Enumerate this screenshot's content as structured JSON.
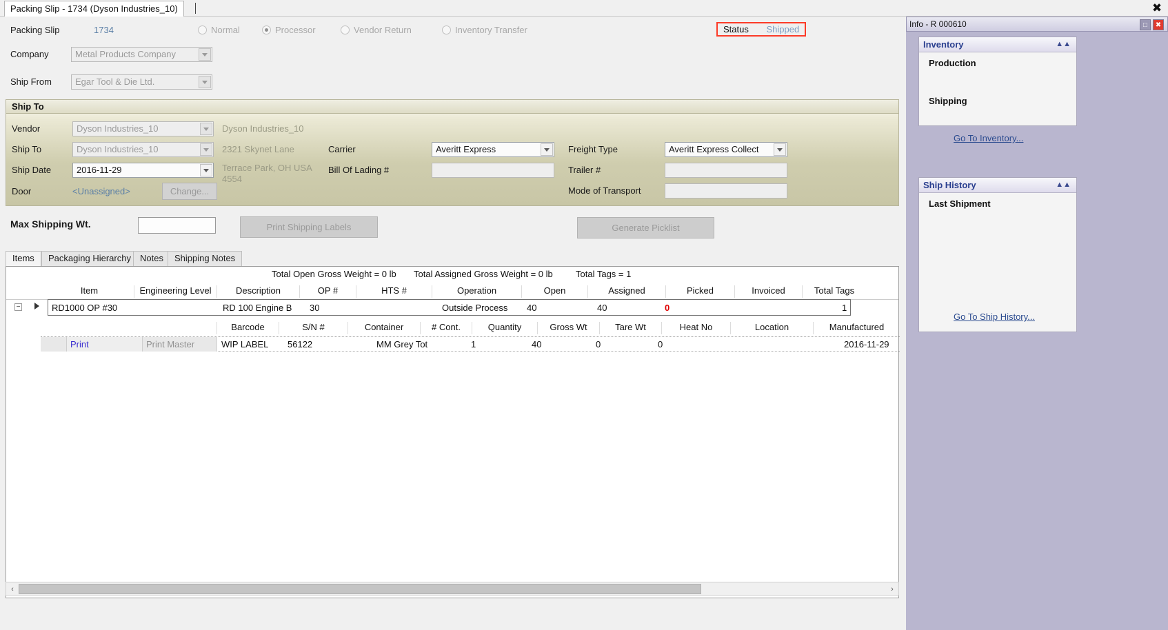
{
  "window": {
    "tab_title": "Packing Slip - 1734 (Dyson Industries_10)",
    "close_icon": "close-icon"
  },
  "header": {
    "packing_slip_label": "Packing Slip",
    "packing_slip_value": "1734",
    "company_label": "Company",
    "company_value": "Metal Products Company",
    "ship_from_label": "Ship From",
    "ship_from_value": "Egar Tool & Die Ltd.",
    "types": [
      {
        "label": "Normal",
        "selected": false
      },
      {
        "label": "Processor",
        "selected": true
      },
      {
        "label": "Vendor Return",
        "selected": false
      },
      {
        "label": "Inventory Transfer",
        "selected": false
      }
    ],
    "status_label": "Status",
    "status_value": "Shipped",
    "status_highlight_color": "#fc3b28"
  },
  "ship_to": {
    "group_title": "Ship To",
    "vendor_label": "Vendor",
    "vendor_value": "Dyson Industries_10",
    "vendor_display": "Dyson Industries_10",
    "ship_to_label": "Ship To",
    "ship_to_value": "Dyson Industries_10",
    "address_line1": "2321 Skynet Lane",
    "address_line2": "Terrace Park, OH USA",
    "address_line3": "4554",
    "ship_date_label": "Ship Date",
    "ship_date_value": "2016-11-29",
    "door_label": "Door",
    "door_value": "<Unassigned>",
    "change_button": "Change...",
    "carrier_label": "Carrier",
    "carrier_value": "Averitt Express",
    "bol_label": "Bill Of Lading #",
    "bol_value": "",
    "freight_type_label": "Freight Type",
    "freight_type_value": "Averitt Express Collect",
    "trailer_label": "Trailer #",
    "trailer_value": "",
    "mode_label": "Mode of Transport",
    "mode_value": ""
  },
  "shipping_bar": {
    "max_weight_label": "Max Shipping Wt.",
    "max_weight_value": "",
    "print_labels_button": "Print Shipping Labels",
    "generate_picklist_button": "Generate Picklist"
  },
  "tabs": [
    {
      "label": "Items",
      "active": true
    },
    {
      "label": "Packaging Hierarchy",
      "active": false
    },
    {
      "label": "Notes",
      "active": false
    },
    {
      "label": "Shipping Notes",
      "active": false
    }
  ],
  "grid": {
    "totals": [
      "Total Open Gross Weight = 0 lb",
      "Total Assigned Gross Weight = 0 lb",
      "Total Tags = 1"
    ],
    "columns": [
      "Item",
      "Engineering Level",
      "Description",
      "OP #",
      "HTS #",
      "Operation",
      "Open",
      "Assigned",
      "Picked",
      "Invoiced",
      "Total Tags"
    ],
    "rows": [
      {
        "item": "RD1000 OP #30",
        "engineering_level": "",
        "description": "RD 100 Engine B",
        "op": "30",
        "hts": "",
        "operation": "Outside Process",
        "open": "40",
        "assigned": "40",
        "picked": "0",
        "invoiced": "",
        "total_tags": "1"
      }
    ],
    "sub_columns": [
      "Barcode",
      "S/N #",
      "Container",
      "# Cont.",
      "Quantity",
      "Gross Wt",
      "Tare Wt",
      "Heat No",
      "Location",
      "Manufactured"
    ],
    "sub_rows": [
      {
        "print_link": "Print",
        "print_master": "Print Master",
        "barcode": "WIP LABEL",
        "sn": "56122",
        "container": "MM Grey Tot",
        "cont_count": "1",
        "quantity": "40",
        "gross_wt": "0",
        "tare_wt": "0",
        "heat_no": "",
        "location": "",
        "manufactured": "2016-11-29"
      }
    ]
  },
  "info_panel": {
    "title": "Info - R 000610",
    "restore_icon": "restore-icon",
    "close_icon": "close-icon",
    "cards": [
      {
        "title": "Inventory",
        "collapse_icon": "chevron-up-icon",
        "items": [
          "Production",
          "Shipping"
        ],
        "link": "Go To Inventory..."
      },
      {
        "title": "Ship History",
        "collapse_icon": "chevron-up-icon",
        "items": [
          "Last Shipment"
        ],
        "link": "Go To Ship History..."
      }
    ]
  },
  "scrollbar": {
    "left_arrow": "‹",
    "right_arrow": "›"
  }
}
